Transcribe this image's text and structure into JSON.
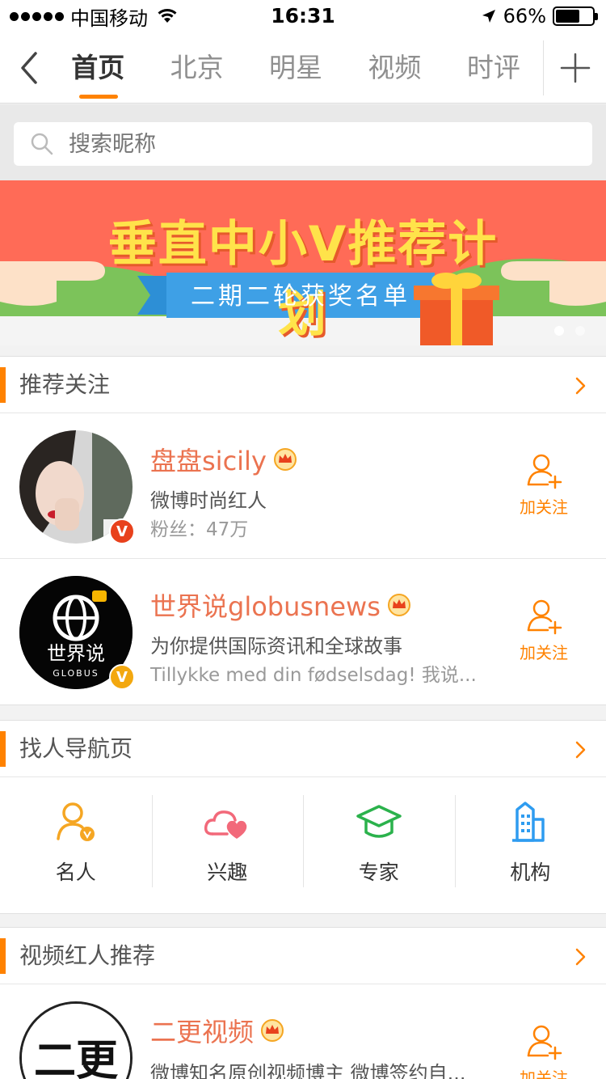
{
  "status_bar": {
    "carrier": "中国移动",
    "time": "16:31",
    "battery": "66%",
    "battery_level": 0.66
  },
  "nav": {
    "tabs": [
      {
        "label": "首页",
        "active": true
      },
      {
        "label": "北京",
        "active": false
      },
      {
        "label": "明星",
        "active": false
      },
      {
        "label": "视频",
        "active": false
      },
      {
        "label": "时评",
        "active": false
      }
    ],
    "back_icon": "chevron-left-icon",
    "add_icon": "plus-icon",
    "accent_color": "#ff8200"
  },
  "search": {
    "placeholder": "搜索昵称",
    "icon": "search-icon"
  },
  "banner": {
    "title": "垂直中小V推荐计划",
    "subtitle": "二期二轮获奖名单",
    "slides": 2,
    "current_slide": 1
  },
  "recommend": {
    "title": "推荐关注",
    "users": [
      {
        "name": "盘盘sicily",
        "desc": "微博时尚红人",
        "meta": "粉丝：47万",
        "follow_label": "加关注",
        "badge": "V",
        "badge_color": "#e8411c"
      },
      {
        "name": "世界说globusnews",
        "desc": "为你提供国际资讯和全球故事",
        "meta": "Tillykke med din fødselsdag! 我说...",
        "follow_label": "加关注",
        "badge": "V",
        "badge_color": "#f3a80f",
        "avatar_text": "世界说",
        "avatar_subtext": "GLOBUS"
      }
    ]
  },
  "finder": {
    "title": "找人导航页",
    "items": [
      {
        "label": "名人",
        "icon": "celebrity-icon"
      },
      {
        "label": "兴趣",
        "icon": "heart-cloud-icon"
      },
      {
        "label": "专家",
        "icon": "graduation-cap-icon"
      },
      {
        "label": "机构",
        "icon": "building-icon"
      }
    ]
  },
  "video": {
    "title": "视频红人推荐",
    "users": [
      {
        "name": "二更视频",
        "desc": "微博知名原创视频博主 微博签约自...",
        "follow_label": "加关注",
        "avatar_text": "二更"
      }
    ]
  }
}
